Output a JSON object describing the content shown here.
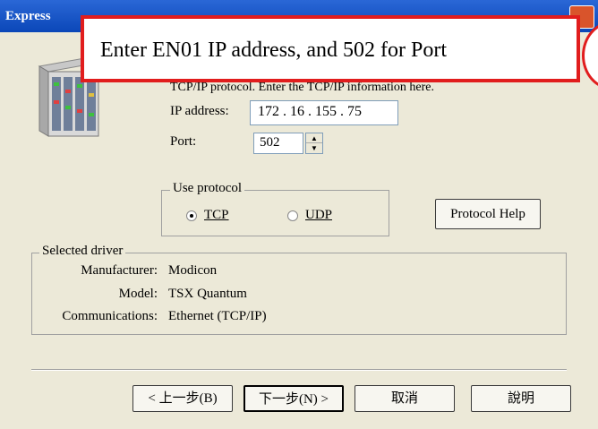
{
  "window": {
    "title": "Express"
  },
  "callout": {
    "text": "Enter EN01 IP address, and 502 for Port"
  },
  "description": "TCP/IP protocol. Enter the TCP/IP information here.",
  "ip": {
    "label": "IP address:",
    "value": "172 . 16 . 155 . 75"
  },
  "port": {
    "label": "Port:",
    "value": "502"
  },
  "protocol": {
    "legend": "Use protocol",
    "tcp": "TCP",
    "udp": "UDP",
    "selected": "TCP"
  },
  "protocol_help_button": "Protocol Help",
  "driver": {
    "legend": "Selected driver",
    "manufacturer_label": "Manufacturer:",
    "manufacturer_value": "Modicon",
    "model_label": "Model:",
    "model_value": "TSX Quantum",
    "communications_label": "Communications:",
    "communications_value": "Ethernet (TCP/IP)"
  },
  "buttons": {
    "back": "< 上一步(B)",
    "next": "下一步(N) >",
    "cancel": "取消",
    "help": "說明"
  },
  "colors": {
    "accent": "#e11d1d",
    "titlebar": "#0b47b8",
    "dialog_bg": "#ece9d8"
  }
}
